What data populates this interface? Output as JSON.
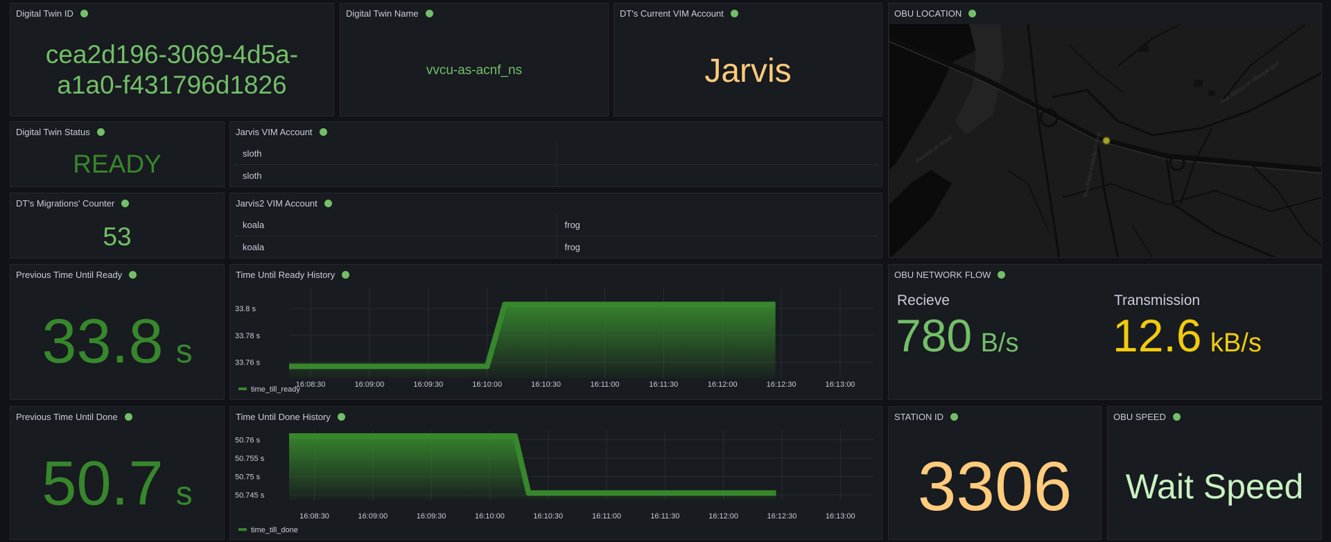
{
  "colors": {
    "green": "#73bf69",
    "dark_green": "#37872d",
    "orange": "#ffcb7d",
    "yellow": "#f2cc0c",
    "light_green": "#c8f2c2",
    "panel_bg": "#181b1f"
  },
  "digital_twin_id": {
    "title": "Digital Twin ID",
    "value_line1": "cea2d196-3069-4d5a-",
    "value_line2": "a1a0-f431796d1826"
  },
  "digital_twin_name": {
    "title": "Digital Twin Name",
    "value": "vvcu-as-acnf_ns"
  },
  "current_vim": {
    "title": "DT's Current VIM Account",
    "value": "Jarvis"
  },
  "obu_location": {
    "title": "OBU LOCATION",
    "map_labels": [
      "Rua Padre Estêvão Cabral",
      "Rua Afonso de Albuquerque",
      "Avenida do Brasil"
    ]
  },
  "dt_status": {
    "title": "Digital Twin Status",
    "value": "READY"
  },
  "jarvis_vim": {
    "title": "Jarvis VIM Account",
    "rows": [
      [
        "sloth",
        ""
      ],
      [
        "sloth",
        ""
      ]
    ]
  },
  "migrations": {
    "title": "DT's Migrations' Counter",
    "value": "53"
  },
  "jarvis2_vim": {
    "title": "Jarvis2 VIM Account",
    "rows": [
      [
        "koala",
        "frog"
      ],
      [
        "koala",
        "frog"
      ]
    ]
  },
  "prev_ready": {
    "title": "Previous Time Until Ready",
    "value": "33.8",
    "unit": "s"
  },
  "prev_done": {
    "title": "Previous Time Until Done",
    "value": "50.7",
    "unit": "s"
  },
  "network_flow": {
    "title": "OBU NETWORK FLOW",
    "receive_label": "Recieve",
    "receive_value": "780",
    "receive_unit": "B/s",
    "transmit_label": "Transmission",
    "transmit_value": "12.6",
    "transmit_unit": "kB/s"
  },
  "station_id": {
    "title": "STATION ID",
    "value": "3306"
  },
  "obu_speed": {
    "title": "OBU SPEED",
    "value": "Wait Speed"
  },
  "chart_data": [
    {
      "type": "area",
      "title": "Time Until Ready History",
      "series": [
        {
          "name": "time_till_ready",
          "points": [
            [
              "16:08:19",
              33.757
            ],
            [
              "16:10:00",
              33.757
            ],
            [
              "16:10:09",
              33.803
            ],
            [
              "16:12:27",
              33.803
            ]
          ]
        }
      ],
      "x_ticks": [
        "16:08:30",
        "16:09:00",
        "16:09:30",
        "16:10:00",
        "16:10:30",
        "16:11:00",
        "16:11:30",
        "16:12:00",
        "16:12:30",
        "16:13:00"
      ],
      "y_ticks": [
        "33.76 s",
        "33.78 s",
        "33.8 s"
      ],
      "y_tick_values": [
        33.76,
        33.78,
        33.8
      ],
      "ylim": [
        33.748,
        33.815
      ],
      "xlim": [
        "16:08:19",
        "16:13:17"
      ],
      "grid": true,
      "legend": "bottom-left"
    },
    {
      "type": "area",
      "title": "Time Until Done History",
      "series": [
        {
          "name": "time_till_done",
          "points": [
            [
              "16:08:17",
              50.761
            ],
            [
              "16:10:13",
              50.761
            ],
            [
              "16:10:20",
              50.7455
            ],
            [
              "16:12:27",
              50.7455
            ]
          ]
        }
      ],
      "x_ticks": [
        "16:08:30",
        "16:09:00",
        "16:09:30",
        "16:10:00",
        "16:10:30",
        "16:11:00",
        "16:11:30",
        "16:12:00",
        "16:12:30",
        "16:13:00"
      ],
      "y_ticks": [
        "50.745 s",
        "50.75 s",
        "50.755 s",
        "50.76 s"
      ],
      "y_tick_values": [
        50.745,
        50.75,
        50.755,
        50.76
      ],
      "ylim": [
        50.7435,
        50.7625
      ],
      "xlim": [
        "16:08:17",
        "16:13:17"
      ],
      "grid": true,
      "legend": "bottom-left"
    }
  ]
}
